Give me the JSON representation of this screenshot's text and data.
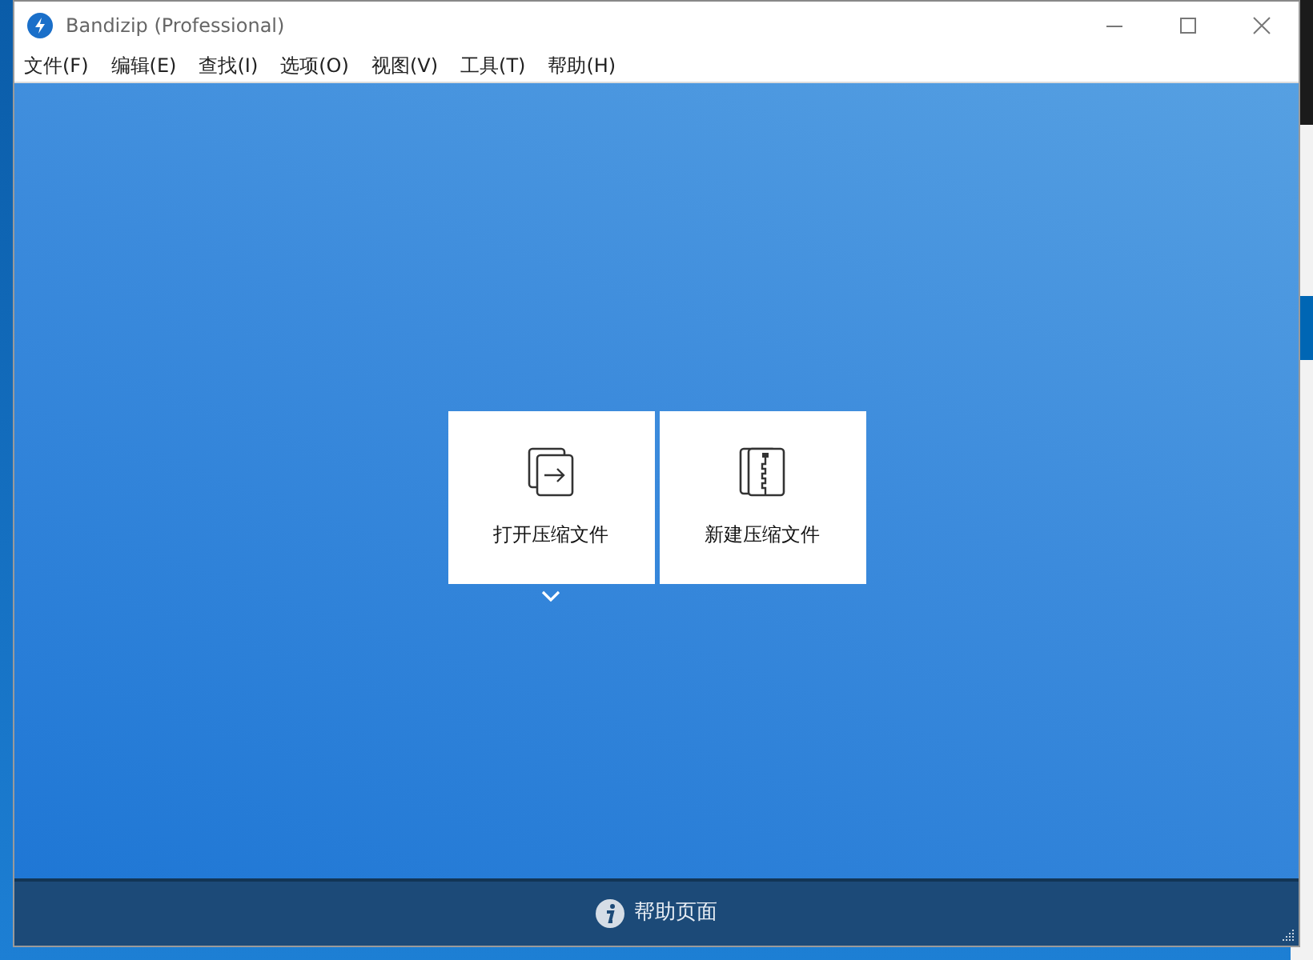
{
  "window": {
    "title": "Bandizip (Professional)"
  },
  "menu": [
    "文件(F)",
    "编辑(E)",
    "查找(I)",
    "选项(O)",
    "视图(V)",
    "工具(T)",
    "帮助(H)"
  ],
  "actions": [
    {
      "kind": "open",
      "label": "打开压缩文件",
      "dropdown": true
    },
    {
      "kind": "new",
      "label": "新建压缩文件",
      "dropdown": false
    }
  ],
  "footer": {
    "label": "帮助页面"
  }
}
